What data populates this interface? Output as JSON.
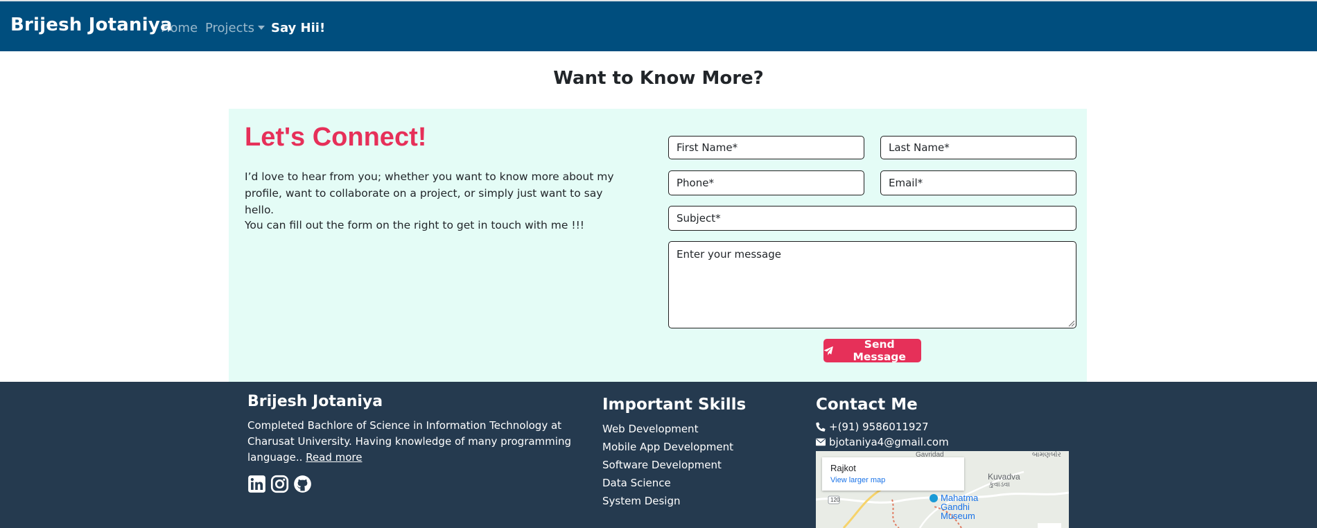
{
  "nav": {
    "brand": "Brijesh Jotaniya",
    "home": "Home",
    "projects": "Projects",
    "say_hi": "Say Hii!"
  },
  "contact_section": {
    "heading": "Want to Know More?",
    "title": "Let's Connect!",
    "intro": "I’d love to hear from you; whether you want to know more about my profile, want to collaborate on a project, or simply just want to say hello.",
    "intro2": "You can fill out the form on the right to get in touch with me !!!"
  },
  "form": {
    "first_name_placeholder": "First Name*",
    "last_name_placeholder": "Last Name*",
    "phone_placeholder": "Phone*",
    "email_placeholder": "Email*",
    "subject_placeholder": "Subject*",
    "message_placeholder": "Enter your message",
    "send_label": "Send Message"
  },
  "footer": {
    "name": "Brijesh Jotaniya",
    "bio": "Completed Bachlore of Science in Information Technology at Charusat University. Having knowledge of many programming language..",
    "read_more": "Read more",
    "social_icons": [
      "linkedin-icon",
      "instagram-icon",
      "github-icon"
    ],
    "skills_title": "Important Skills",
    "skills": [
      "Web Development",
      "Mobile App Development",
      "Software Development",
      "Data Science",
      "System Design"
    ],
    "contact_title": "Contact Me",
    "phone": "+(91) 9586011927",
    "email": "bjotaniya4@gmail.com"
  },
  "map": {
    "place": "Rajkot",
    "link": "View larger map",
    "labels": {
      "gavridad": "Gavridad",
      "kuvadva": "Kuvadva",
      "kuvadva_gu": "કુવાડવા",
      "top_right_gu": "બામણબોર",
      "museum": "Mahatma Gandhi Museum",
      "road": "120"
    }
  },
  "colors": {
    "navbar": "#004e7e",
    "accent": "#e63059",
    "panel": "#e4fcf6",
    "footer": "#253a4f"
  }
}
